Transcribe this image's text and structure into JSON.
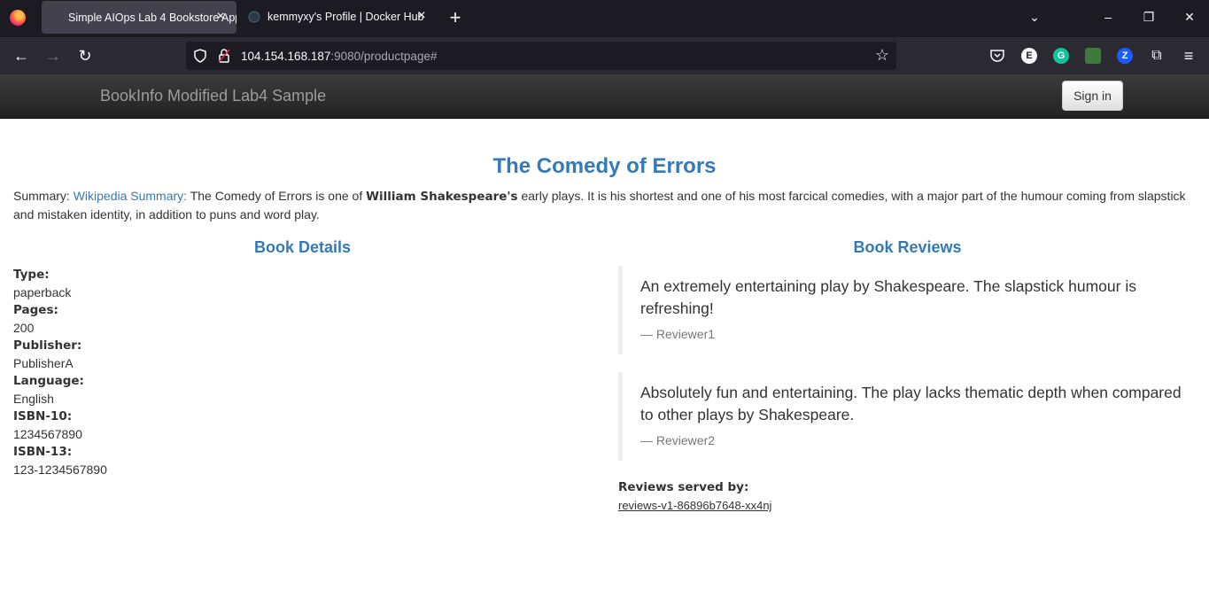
{
  "browser": {
    "tabs": [
      {
        "title": "Simple AIOps Lab 4 Bookstore App",
        "active": true
      },
      {
        "title": "kemmyxy's Profile | Docker Hub",
        "active": false
      }
    ],
    "url": {
      "host": "104.154.168.187",
      "rest": ":9080/productpage#"
    },
    "extensions": [
      {
        "name": "E",
        "color": "#f9f9fa"
      },
      {
        "name": "G",
        "color": "#15c39a"
      },
      {
        "name": "Z",
        "color": "#1a5cff"
      }
    ]
  },
  "app": {
    "brand": "BookInfo Modified Lab4 Sample",
    "signin_label": "Sign in"
  },
  "book": {
    "title": "The Comedy of Errors",
    "summary_label": "Summary: ",
    "summary_link": "Wikipedia Summary:",
    "summary_pre": " The Comedy of Errors is one of ",
    "summary_bold": "William Shakespeare's",
    "summary_post": " early plays. It is his shortest and one of his most farcical comedies, with a major part of the humour coming from slapstick and mistaken identity, in addition to puns and word play."
  },
  "details": {
    "heading": "Book Details",
    "items": [
      {
        "label": "Type:",
        "value": "paperback"
      },
      {
        "label": "Pages:",
        "value": "200"
      },
      {
        "label": "Publisher:",
        "value": "PublisherA"
      },
      {
        "label": "Language:",
        "value": "English"
      },
      {
        "label": "ISBN-10:",
        "value": "1234567890"
      },
      {
        "label": "ISBN-13:",
        "value": "123-1234567890"
      }
    ]
  },
  "reviews": {
    "heading": "Book Reviews",
    "items": [
      {
        "text": "An extremely entertaining play by Shakespeare. The slapstick humour is refreshing!",
        "reviewer": "— Reviewer1"
      },
      {
        "text": "Absolutely fun and entertaining. The play lacks thematic depth when compared to other plays by Shakespeare.",
        "reviewer": "— Reviewer2"
      }
    ],
    "served_label": "Reviews served by:",
    "served_by": "reviews-v1-86896b7648-xx4nj"
  }
}
